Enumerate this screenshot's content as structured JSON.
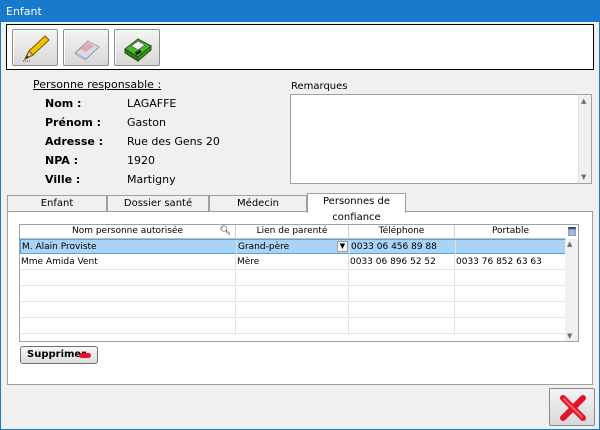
{
  "window": {
    "title": "Enfant"
  },
  "toolbar": {
    "edit_icon": "pencil-icon",
    "erase_icon": "eraser-icon",
    "save_icon": "save-icon"
  },
  "person": {
    "section_title": "Personne responsable :",
    "fields": [
      {
        "label": "Nom :",
        "value": "LAGAFFE"
      },
      {
        "label": "Prénom :",
        "value": "Gaston"
      },
      {
        "label": "Adresse :",
        "value": "Rue des Gens 20"
      },
      {
        "label": "NPA :",
        "value": "1920"
      },
      {
        "label": "Ville :",
        "value": "Martigny"
      }
    ]
  },
  "remarks": {
    "label": "Remarques",
    "value": ""
  },
  "tabs": [
    {
      "label": "Enfant",
      "active": false
    },
    {
      "label": "Dossier santé",
      "active": false
    },
    {
      "label": "Médecin",
      "active": false
    },
    {
      "label": "Personnes de confiance",
      "active": true
    }
  ],
  "grid": {
    "columns": [
      "Nom personne autorisée",
      "Lien de parenté",
      "Téléphone",
      "Portable"
    ],
    "rows": [
      {
        "name": "M. Alain Proviste",
        "relation": "Grand-père",
        "phone": "0033 06 456 89 88",
        "mobile": "",
        "selected": true
      },
      {
        "name": "Mme Amida Vent",
        "relation": "Mère",
        "phone": "0033 06 896 52 52",
        "mobile": "0033 76 852 63 63",
        "selected": false
      }
    ]
  },
  "actions": {
    "delete_label": "Supprimer",
    "close_icon": "close-icon"
  },
  "colors": {
    "titlebar": "#1979ca",
    "selection": "#a9d3f7",
    "delete_red": "#e0142c",
    "close_red": "#e0142c"
  }
}
